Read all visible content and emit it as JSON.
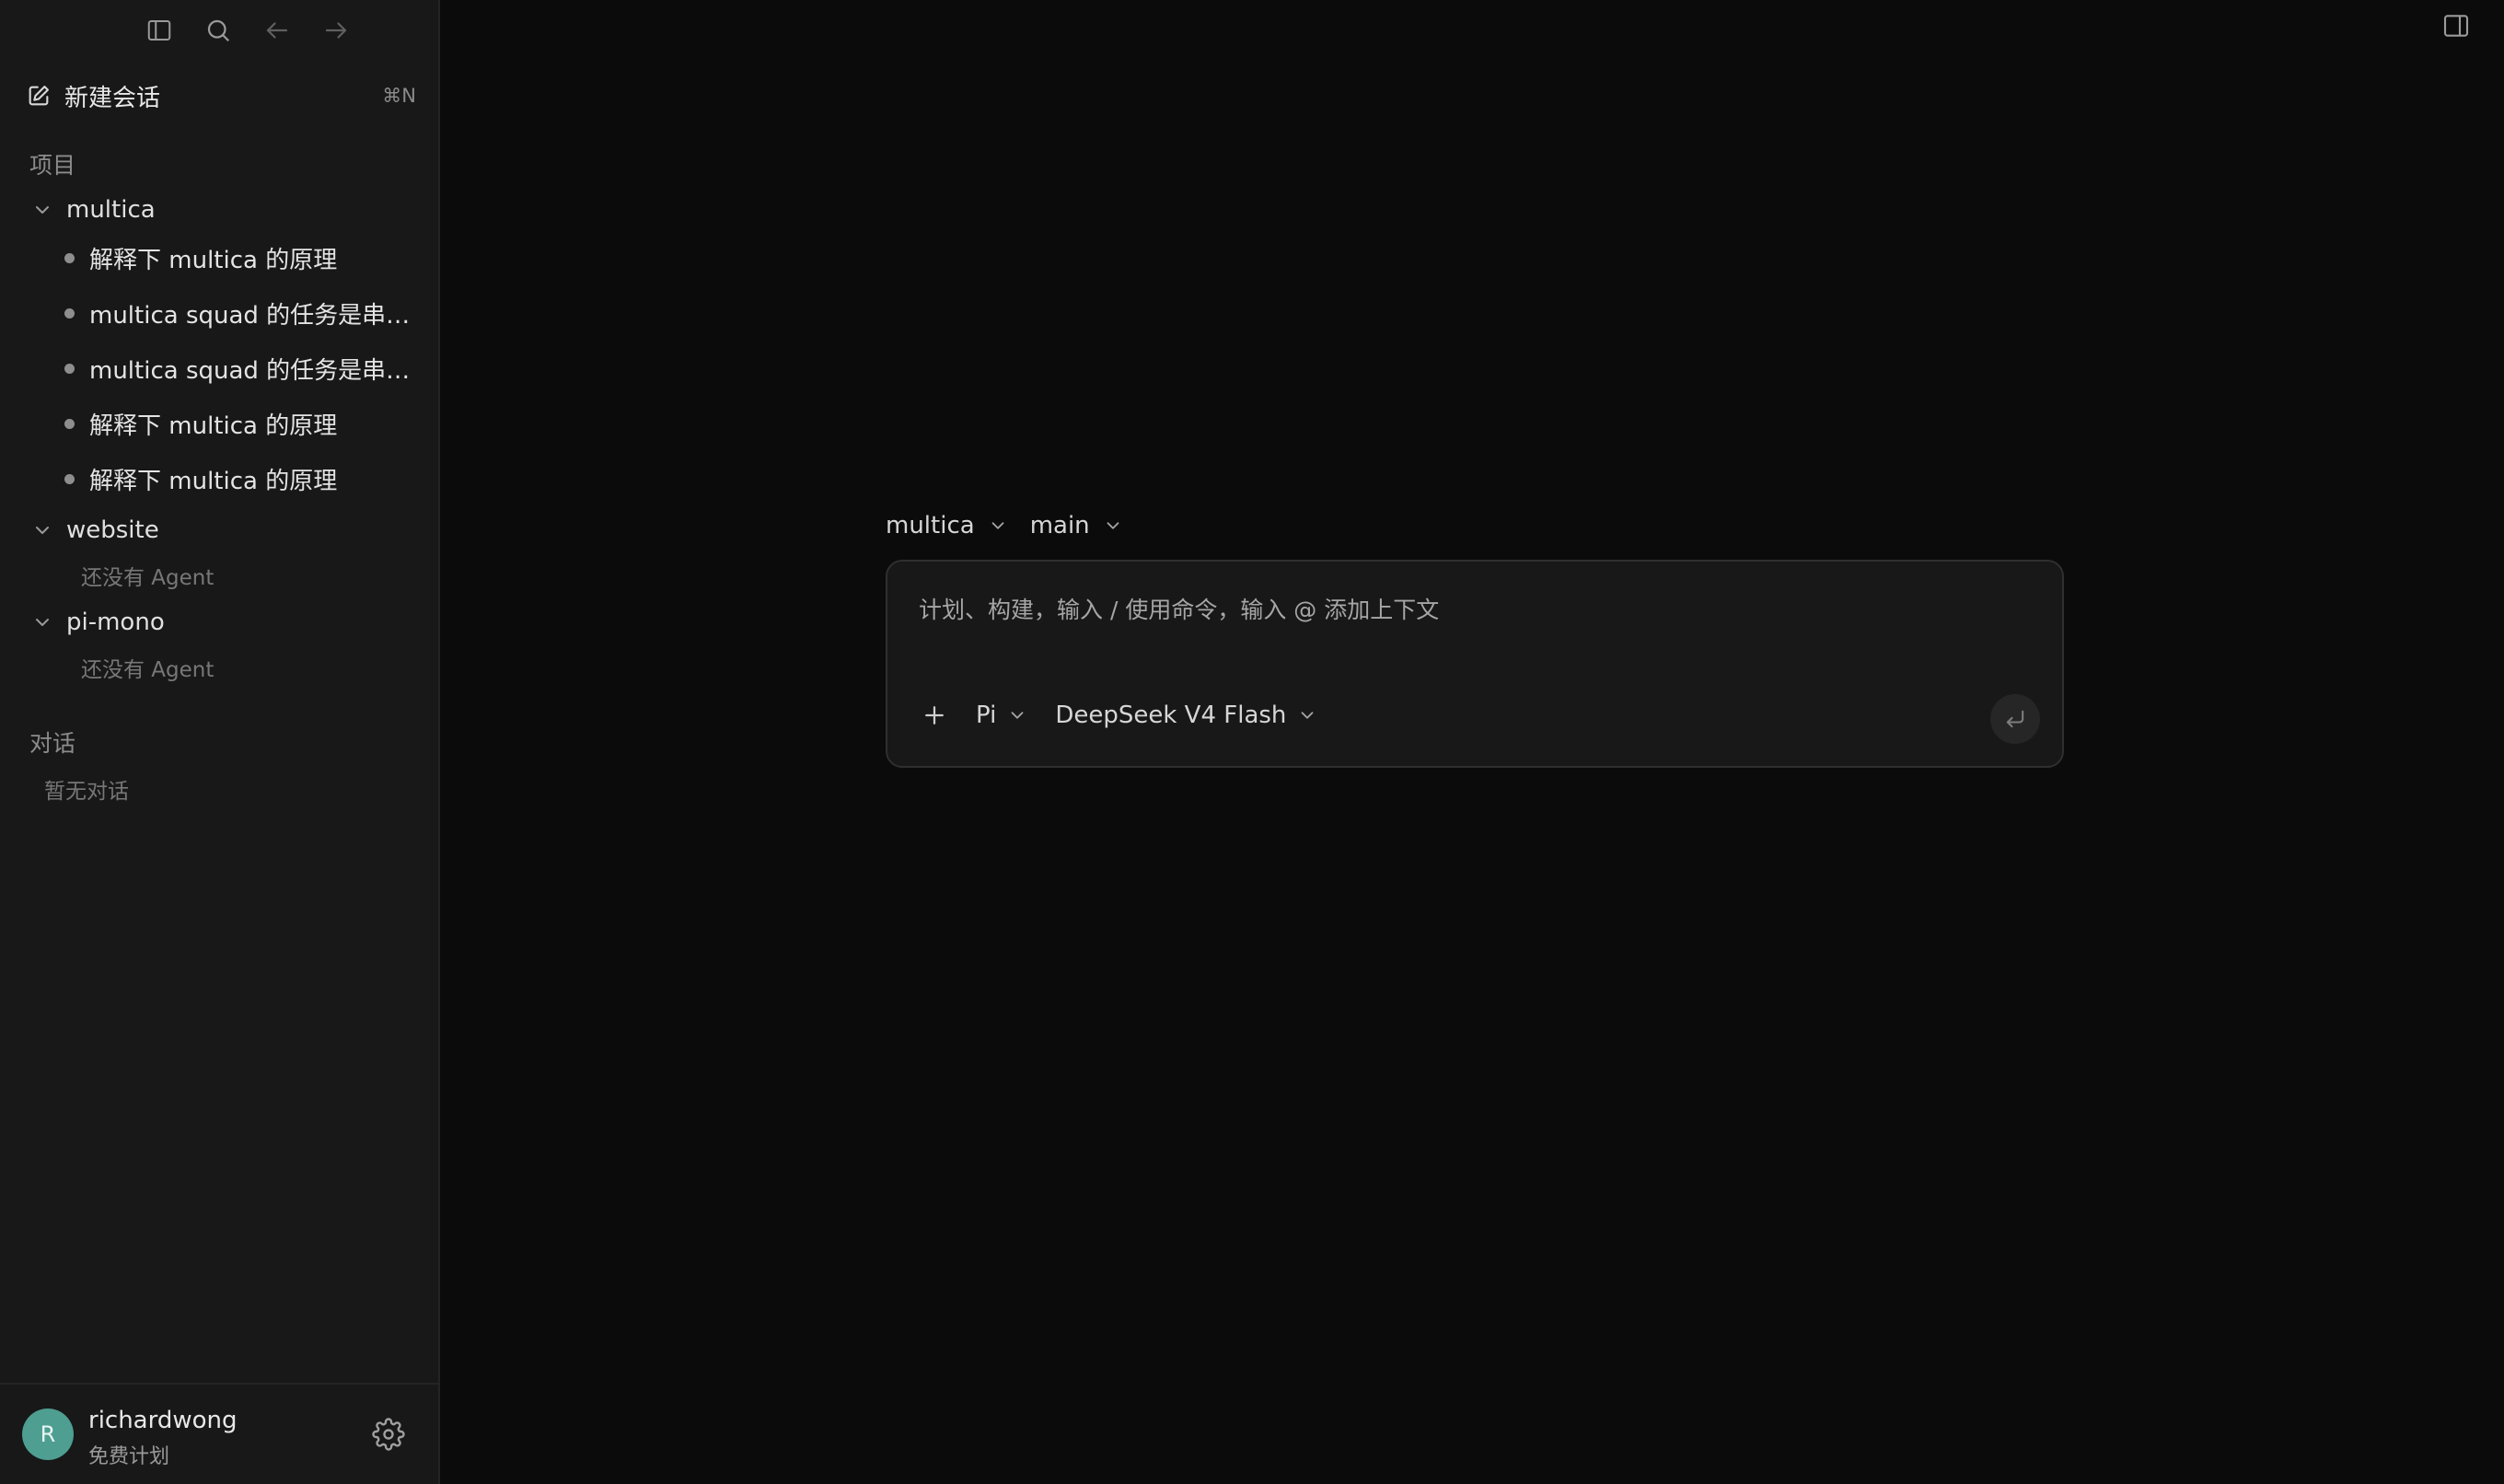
{
  "sidebar": {
    "new_chat": {
      "label": "新建会话",
      "shortcut": "⌘N"
    },
    "projects_title": "项目",
    "projects": [
      {
        "name": "multica",
        "sessions": [
          "解释下 multica 的原理",
          "multica squad 的任务是串行还是并行执行的",
          "multica squad 的任务是串行还是并行执行的",
          "解释下 multica 的原理",
          "解释下 multica 的原理"
        ]
      },
      {
        "name": "website",
        "empty_note": "还没有 Agent"
      },
      {
        "name": "pi-mono",
        "empty_note": "还没有 Agent"
      }
    ],
    "conversations_title": "对话",
    "conversations_empty": "暂无对话",
    "user": {
      "initial": "R",
      "name": "richardwong",
      "plan": "免费计划"
    }
  },
  "main": {
    "project_selector": "multica",
    "branch_selector": "main",
    "composer": {
      "placeholder": "计划、构建，输入 / 使用命令，输入 @ 添加上下文",
      "agent": "Pi",
      "model": "DeepSeek V4 Flash"
    }
  },
  "icons": {
    "sidebar_toggle": "sidebar-toggle-icon",
    "search": "search-icon",
    "back": "arrow-left-icon",
    "forward": "arrow-right-icon",
    "new_chat": "edit-icon",
    "settings": "gear-icon",
    "panel": "panel-right-icon",
    "send": "enter-icon"
  },
  "colors": {
    "background": "#0b0b0b",
    "sidebar": "#181818",
    "avatar": "#4e9e92"
  }
}
